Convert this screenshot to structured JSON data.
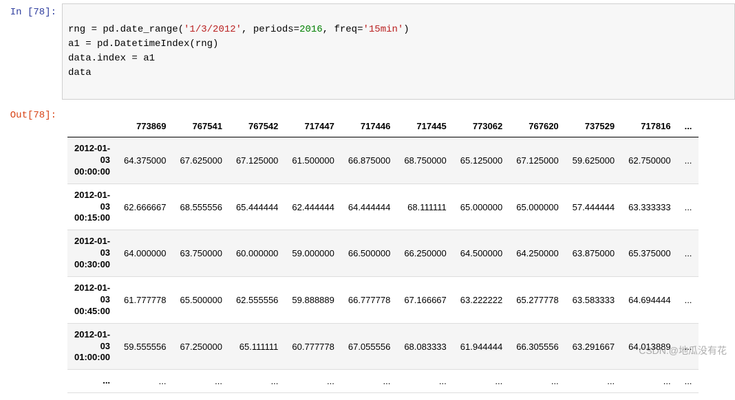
{
  "input_prompt": "In [78]:",
  "output_prompt": "Out[78]:",
  "code": {
    "line1_a": "rng = pd.date_range(",
    "line1_s1": "'1/3/2012'",
    "line1_b": ", periods=",
    "line1_n1": "2016",
    "line1_c": ", freq=",
    "line1_s2": "'15min'",
    "line1_d": ")",
    "line2": "a1 = pd.DatetimeIndex(rng)",
    "line3": "data.index = a1",
    "line4": "data"
  },
  "table": {
    "columns": [
      "773869",
      "767541",
      "767542",
      "717447",
      "717446",
      "717445",
      "773062",
      "767620",
      "737529",
      "717816",
      "..."
    ],
    "index": [
      "2012-01-03 00:00:00",
      "2012-01-03 00:15:00",
      "2012-01-03 00:30:00",
      "2012-01-03 00:45:00",
      "2012-01-03 01:00:00",
      "..."
    ],
    "rows": [
      [
        "64.375000",
        "67.625000",
        "67.125000",
        "61.500000",
        "66.875000",
        "68.750000",
        "65.125000",
        "67.125000",
        "59.625000",
        "62.750000",
        "..."
      ],
      [
        "62.666667",
        "68.555556",
        "65.444444",
        "62.444444",
        "64.444444",
        "68.111111",
        "65.000000",
        "65.000000",
        "57.444444",
        "63.333333",
        "..."
      ],
      [
        "64.000000",
        "63.750000",
        "60.000000",
        "59.000000",
        "66.500000",
        "66.250000",
        "64.500000",
        "64.250000",
        "63.875000",
        "65.375000",
        "..."
      ],
      [
        "61.777778",
        "65.500000",
        "62.555556",
        "59.888889",
        "66.777778",
        "67.166667",
        "63.222222",
        "65.277778",
        "63.583333",
        "64.694444",
        "..."
      ],
      [
        "59.555556",
        "67.250000",
        "65.111111",
        "60.777778",
        "67.055556",
        "68.083333",
        "61.944444",
        "66.305556",
        "63.291667",
        "64.013889",
        "..."
      ],
      [
        "...",
        "...",
        "...",
        "...",
        "...",
        "...",
        "...",
        "...",
        "...",
        "...",
        "..."
      ]
    ]
  },
  "watermark": "CSDN.@地瓜没有花"
}
